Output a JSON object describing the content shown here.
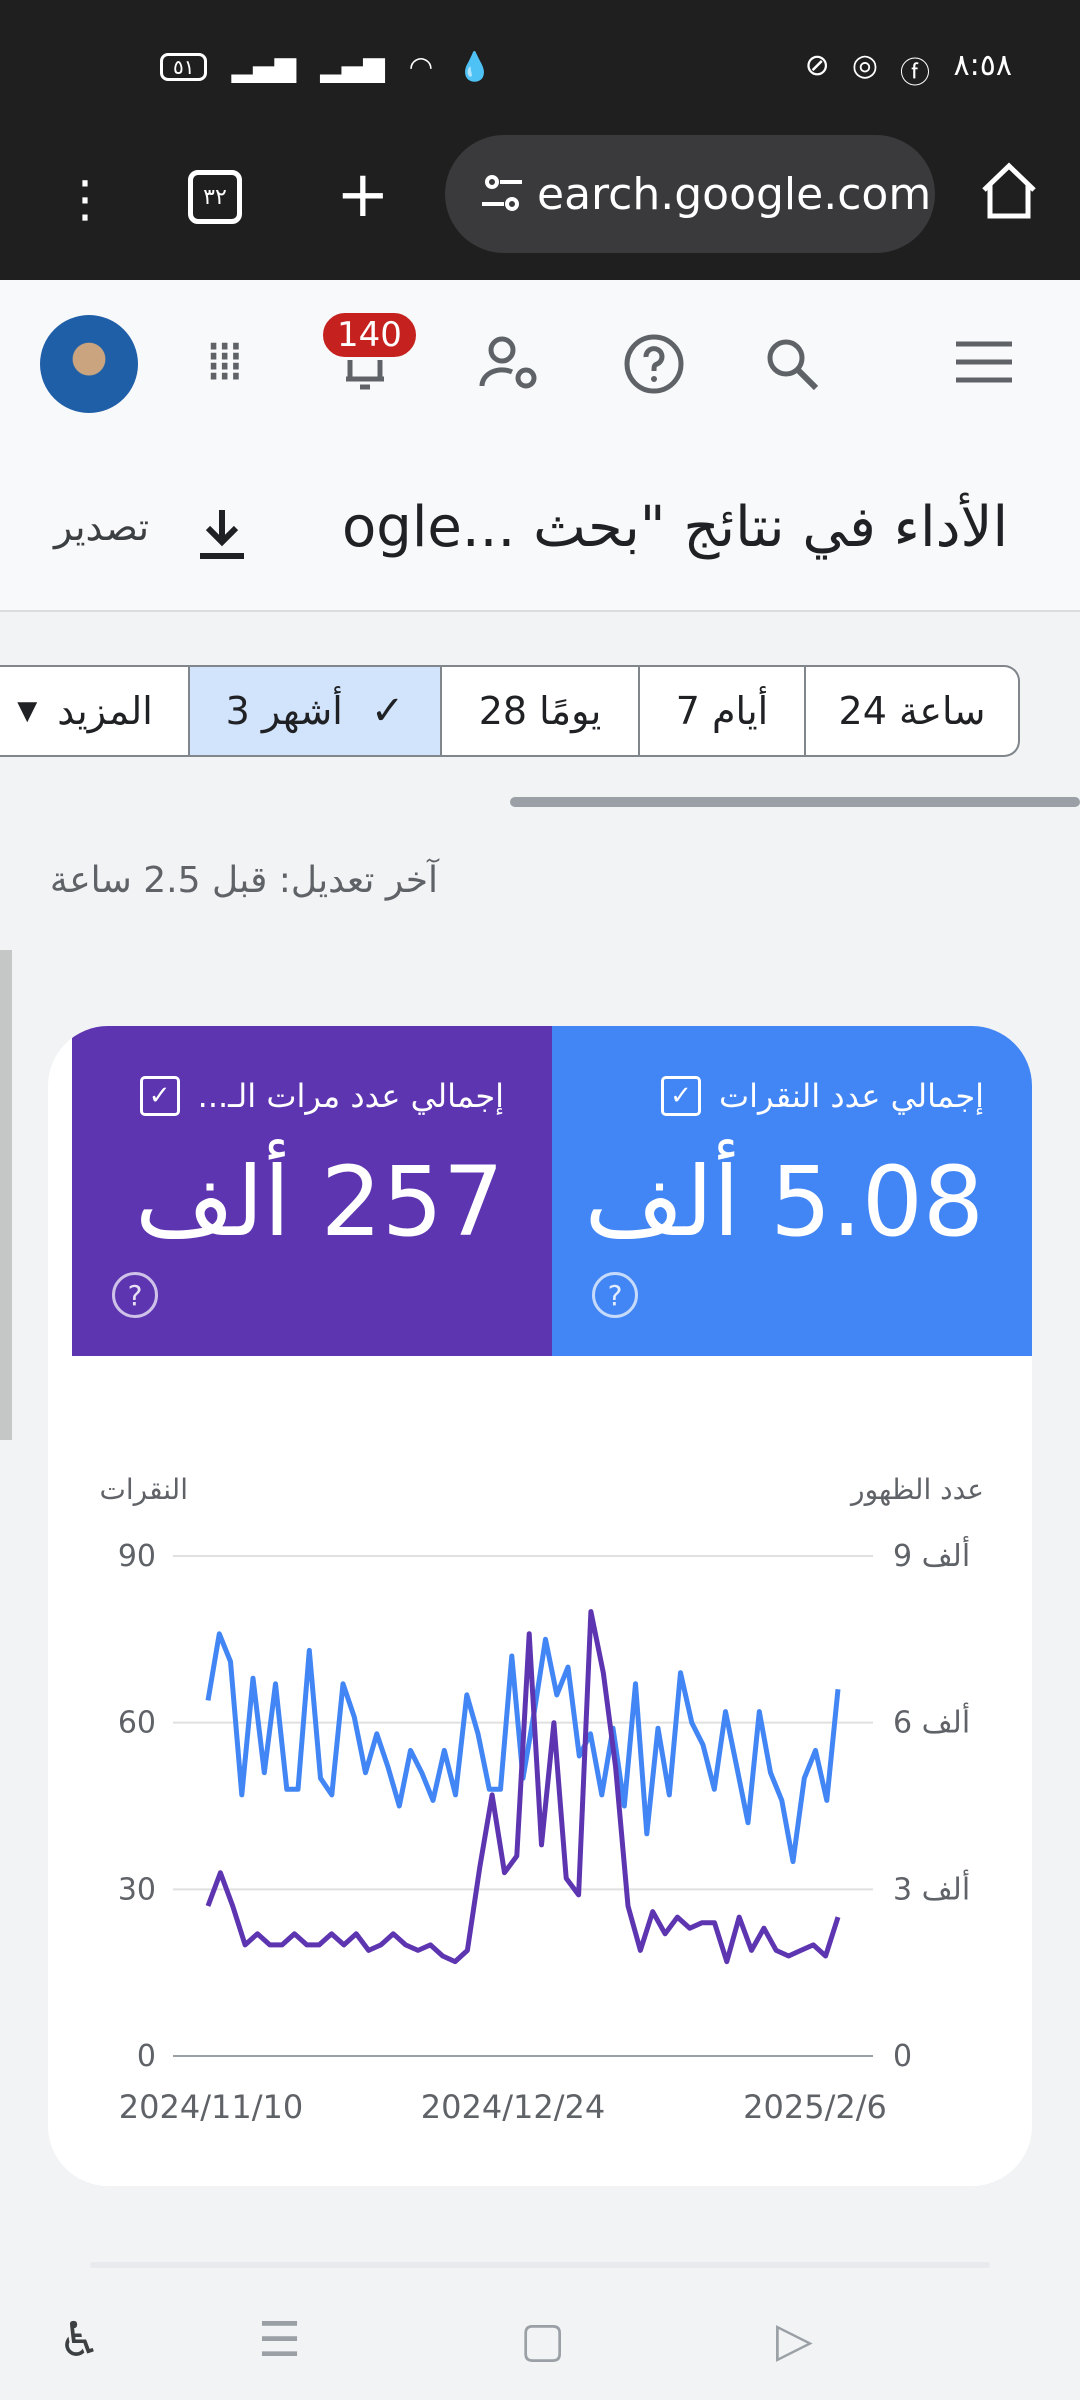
{
  "status": {
    "time": "٨:٥٨",
    "battery": "٥١",
    "left_icons": [
      "wifi",
      "signal",
      "signal",
      "battery"
    ],
    "right_icons": [
      "facebook",
      "instagram",
      "notification"
    ]
  },
  "browser": {
    "tab_count": "٣٢",
    "url": "search.google.com",
    "url_visible": "earch.google.com"
  },
  "header": {
    "notification_count": "140",
    "title": "الأداء في نتائج \"بحث ...ogle",
    "export_label": "تصدير"
  },
  "date_range": {
    "options": [
      "المزيد",
      "3 أشهر",
      "28 يومًا",
      "7 أيام",
      "24 ساعة"
    ],
    "selected": "3 أشهر"
  },
  "last_updated": "آخر تعديل: قبل 2.5 ساعة",
  "metrics": {
    "clicks": {
      "label": "إجمالي عدد النقرات",
      "value": "5.08 ألف",
      "color": "#4285f4"
    },
    "impressions": {
      "label": "إجمالي عدد مرات الـ...",
      "value": "257 ألف",
      "color": "#5e35b1"
    }
  },
  "chart_data": {
    "type": "line",
    "x_tick_labels": [
      "2024/11/10",
      "2024/12/24",
      "2025/2/6"
    ],
    "left_axis": {
      "title": "النقرات",
      "ticks": [
        "0",
        "30",
        "60",
        "90"
      ],
      "range": [
        0,
        90
      ]
    },
    "right_axis": {
      "title": "عدد الظهور",
      "ticks": [
        "0",
        "3 ألف",
        "6 ألف",
        "9 ألف"
      ],
      "range": [
        0,
        9000
      ]
    },
    "grid": true,
    "series": [
      {
        "axis": "left",
        "color": "#4285f4",
        "values": [
          64,
          76,
          71,
          47,
          68,
          51,
          67,
          48,
          48,
          73,
          50,
          47,
          67,
          61,
          51,
          58,
          52,
          45,
          55,
          51,
          46,
          55,
          47,
          65,
          58,
          48,
          48,
          72,
          50,
          62,
          75,
          65,
          70,
          54,
          58,
          47,
          59,
          45,
          67,
          40,
          59,
          47,
          69,
          60,
          56,
          48,
          62,
          52,
          42,
          62,
          51,
          46,
          35,
          50,
          55,
          46,
          66
        ]
      },
      {
        "axis": "right",
        "color": "#5e35b1",
        "values": [
          2700,
          3300,
          2700,
          2000,
          2200,
          2000,
          2000,
          2200,
          2000,
          2000,
          2200,
          2000,
          2200,
          1900,
          2000,
          2200,
          2000,
          1900,
          2000,
          1800,
          1700,
          1900,
          3400,
          4700,
          3300,
          3600,
          7600,
          3800,
          6000,
          3200,
          2900,
          8000,
          6900,
          5200,
          2700,
          1900,
          2600,
          2200,
          2500,
          2300,
          2400,
          2400,
          1700,
          2500,
          1900,
          2300,
          1900,
          1800,
          1900,
          2000,
          1800,
          2500
        ]
      }
    ]
  }
}
